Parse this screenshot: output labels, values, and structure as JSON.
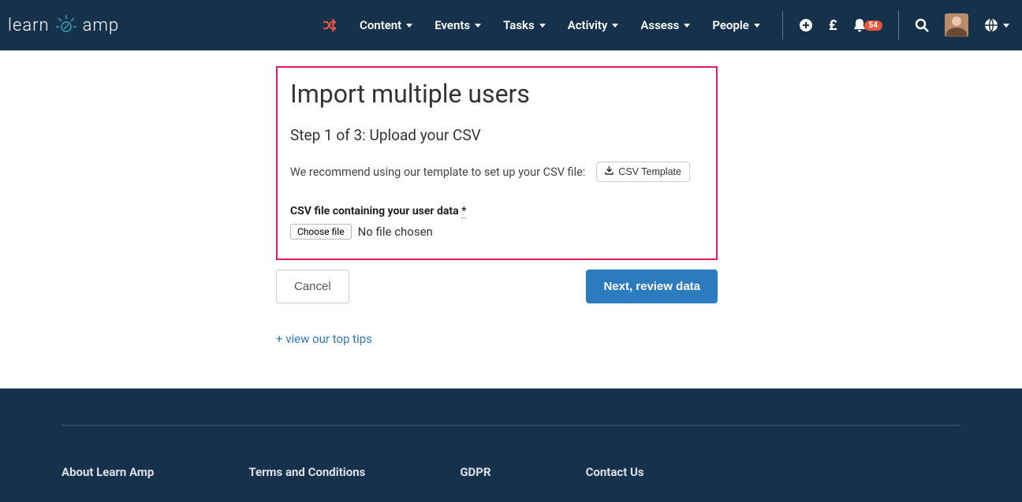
{
  "brand": {
    "part1": "learn",
    "part2": "amp"
  },
  "nav": {
    "items": [
      {
        "label": "Content"
      },
      {
        "label": "Events"
      },
      {
        "label": "Tasks"
      },
      {
        "label": "Activity"
      },
      {
        "label": "Assess"
      },
      {
        "label": "People"
      }
    ],
    "pound": "£",
    "notification_count": "54"
  },
  "page": {
    "title": "Import multiple users",
    "step": "Step 1 of 3: Upload your CSV",
    "recommend_text": "We recommend using our template to set up your CSV file:",
    "template_btn": "CSV Template",
    "field_label": "CSV file containing your user data ",
    "required_mark": "*",
    "choose_file": "Choose file",
    "file_status": "No file chosen",
    "cancel": "Cancel",
    "next": "Next, review data",
    "tips": "+ view our top tips"
  },
  "footer": {
    "cols": [
      "About Learn Amp",
      "Terms and Conditions",
      "GDPR",
      "Contact Us"
    ]
  }
}
